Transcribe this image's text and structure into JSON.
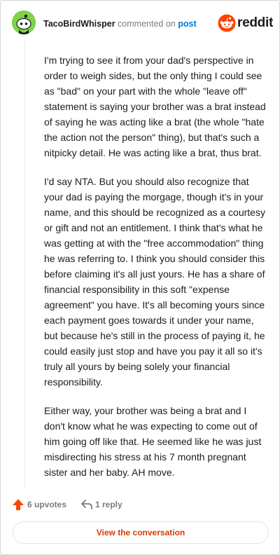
{
  "comment": {
    "author": "TacoBirdWhisper",
    "action_text": "commented on",
    "post_link": "post",
    "paragraphs": [
      "I'm trying to see it from your dad's perspective in order to weigh sides, but the only thing I could see as \"bad\" on your part with the whole \"leave off\" statement is saying your brother was a brat instead of saying he was acting like a brat (the whole \"hate the action not the person\" thing), but that's such a nitpicky detail. He was acting like a brat, thus brat.",
      "I'd say NTA. But you should also recognize that your dad is paying the morgage, though it's in your name, and this should be recognized as a courtesy or gift and not an entitlement. I think that's what he was getting at with the \"free accommodation\" thing he was referring to. I think you should consider this before claiming it's all just yours. He has a share of financial responsibility in this soft \"expense agreement\" you have. It's all becoming yours since each payment goes towards it under your name, but because he's still in the process of paying it, he could easily just stop and have you pay it all so it's truly all yours by being solely your financial responsibility.",
      "Either way, your brother was being a brat and I don't know what he was expecting to come out of him going off like that. He seemed like he was just misdirecting his stress at his 7 month pregnant sister and her baby. AH move."
    ],
    "upvotes_label": "6 upvotes",
    "reply_label": "1 reply"
  },
  "brand": {
    "wordmark": "reddit"
  },
  "footer": {
    "view_conversation_label": "View the conversation"
  },
  "colors": {
    "upvote": "#ff4500",
    "brand": "#ff4500",
    "link": "#0079d3",
    "button_text": "#d93a00",
    "avatar": "#7fd24a"
  }
}
